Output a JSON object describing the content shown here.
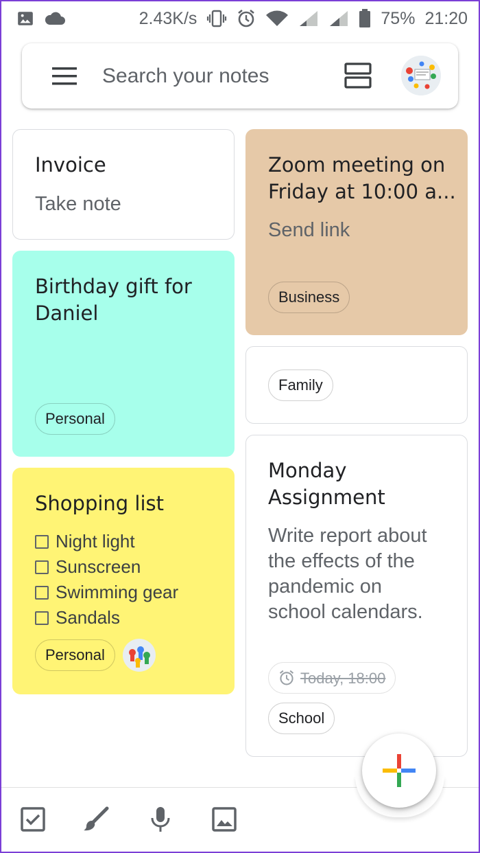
{
  "status_bar": {
    "speed": "2.43K/s",
    "battery": "75%",
    "time": "21:20"
  },
  "search": {
    "placeholder": "Search your notes"
  },
  "notes": {
    "invoice": {
      "title": "Invoice",
      "body": "Take note"
    },
    "zoom": {
      "title_line1": "Zoom meeting on",
      "title_line2": "Friday at 10:00 a...",
      "body": "Send link",
      "label": "Business",
      "color": "#e6c9a8"
    },
    "birthday": {
      "title_line1": "Birthday gift for",
      "title_line2": "Daniel",
      "label": "Personal",
      "color": "#a7ffeb"
    },
    "family": {
      "label": "Family"
    },
    "shopping": {
      "title": "Shopping list",
      "items": [
        "Night light",
        "Sunscreen",
        "Swimming gear",
        "Sandals"
      ],
      "label": "Personal",
      "color": "#fff475"
    },
    "monday": {
      "title_line1": "Monday",
      "title_line2": "Assignment",
      "body": [
        "Write report about",
        "the effects of the",
        "pandemic on",
        "school calendars."
      ],
      "reminder": "Today, 18:00",
      "label": "School"
    }
  },
  "bottom_bar": {
    "icons": [
      "checkbox-icon",
      "brush-icon",
      "mic-icon",
      "image-icon"
    ]
  },
  "fab": {
    "icon": "plus-icon"
  }
}
